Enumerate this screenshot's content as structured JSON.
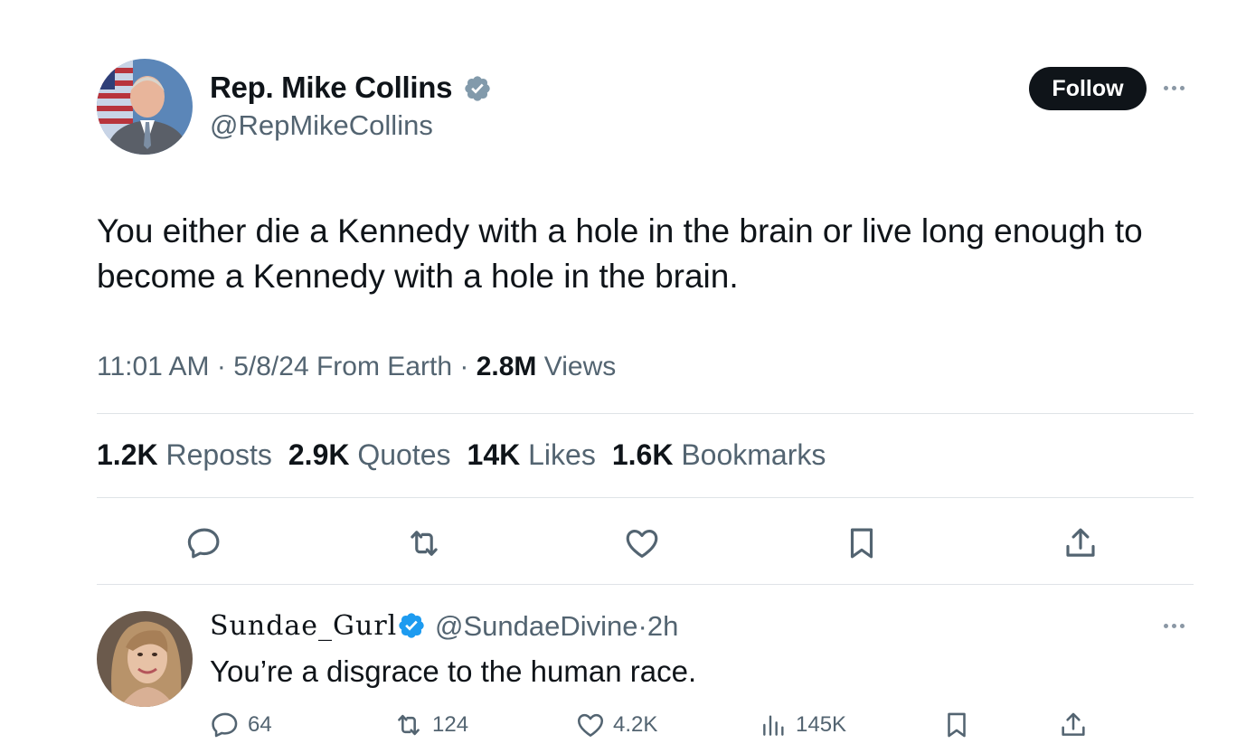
{
  "author": {
    "name": "Rep. Mike Collins",
    "handle": "@RepMikeCollins",
    "verified_color": "#829aab"
  },
  "follow_label": "Follow",
  "tweet": {
    "text": "You either die a Kennedy with a hole in the brain or live long enough to become a Kennedy with a hole in the brain.",
    "time": "11:01 AM",
    "date": "5/8/24",
    "source": "From Earth",
    "views_count": "2.8M",
    "views_label": "Views",
    "separator": "·"
  },
  "stats": [
    {
      "count": "1.2K",
      "label": "Reposts"
    },
    {
      "count": "2.9K",
      "label": "Quotes"
    },
    {
      "count": "14K",
      "label": "Likes"
    },
    {
      "count": "1.6K",
      "label": "Bookmarks"
    }
  ],
  "actions": [
    "reply-icon",
    "repost-icon",
    "like-icon",
    "bookmark-icon",
    "share-icon"
  ],
  "reply": {
    "name": "Sundae_Gurl",
    "handle": "@SundaeDivine",
    "time": "2h",
    "separator": "·",
    "verified_color": "#1d9bf0",
    "text": "You’re a disgrace to the human race.",
    "replies": "64",
    "reposts": "124",
    "likes": "4.2K",
    "views": "145K"
  }
}
